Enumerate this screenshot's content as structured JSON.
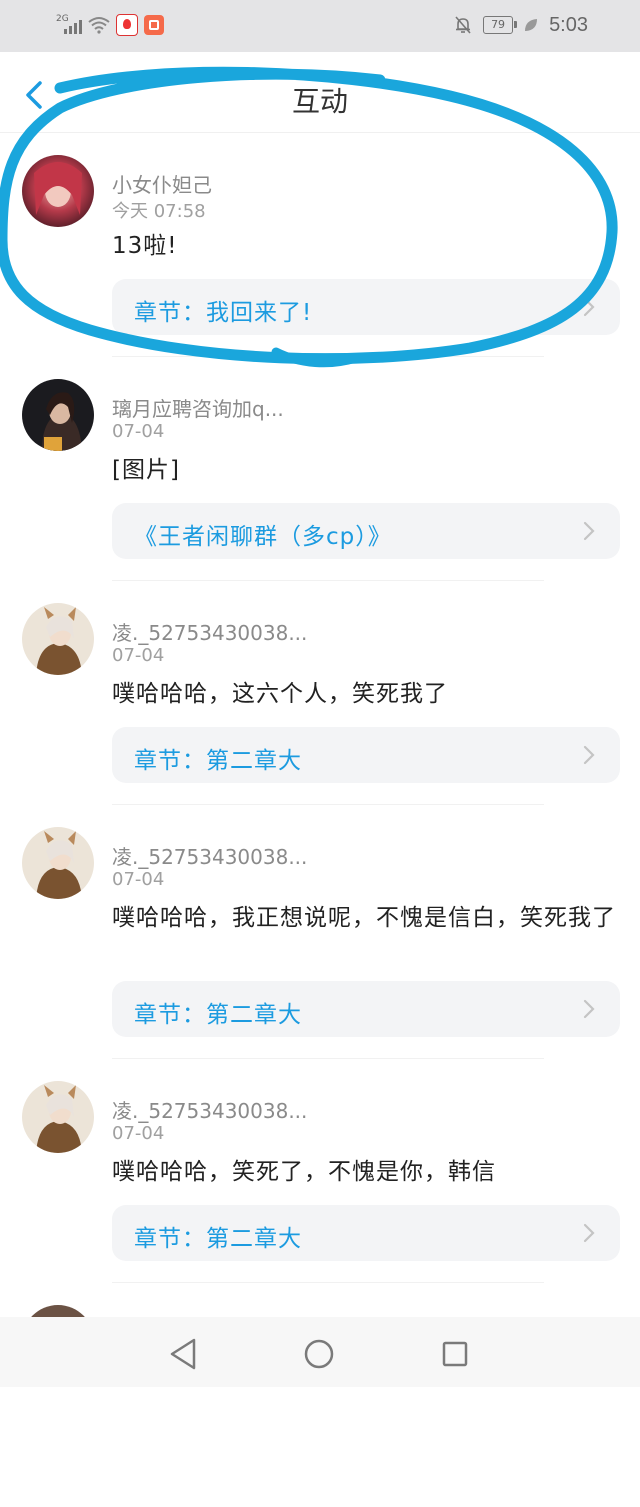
{
  "status_bar": {
    "network": "2G",
    "battery": "79",
    "time": "5:03"
  },
  "header": {
    "title": "互动"
  },
  "colors": {
    "accent": "#1c9be0",
    "scribble": "#1aa6dc"
  },
  "items": [
    {
      "user": "小女仆妲己",
      "date": "今天 07:58",
      "message": "13啦!",
      "link": "章节：我回来了!"
    },
    {
      "user": "璃月应聘咨询加q...",
      "date": "07-04",
      "message": "[图片]",
      "link": "《王者闲聊群（多cp）》"
    },
    {
      "user": "凌._52753430038...",
      "date": "07-04",
      "message": "噗哈哈哈，这六个人，笑死我了",
      "link": "章节：第二章大"
    },
    {
      "user": "凌._52753430038...",
      "date": "07-04",
      "message": "噗哈哈哈，我正想说呢，不愧是信白，笑死我了",
      "link": "章节：第二章大"
    },
    {
      "user": "凌._52753430038...",
      "date": "07-04",
      "message": "噗哈哈哈，笑死了，不愧是你，韩信",
      "link": "章节：第二章大"
    }
  ]
}
